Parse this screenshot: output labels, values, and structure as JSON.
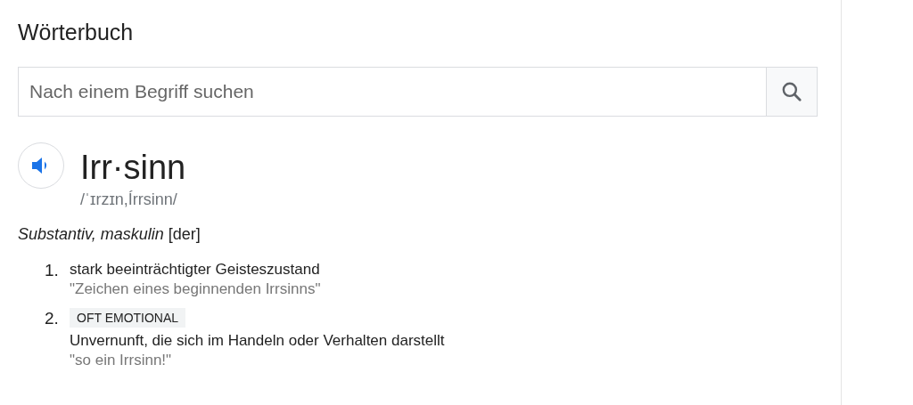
{
  "title": "Wörterbuch",
  "search": {
    "placeholder": "Nach einem Begriff suchen"
  },
  "entry": {
    "word": "Irr·sinn",
    "phonetic": "/ˈɪrzɪn,Írrsinn/",
    "part_of_speech": "*Substantiv, maskulin* [der]",
    "definitions": [
      {
        "number": "1.",
        "definition": "stark beeinträchtigter Geisteszustand",
        "example": "\"Zeichen eines beginnenden Irrsinns\""
      },
      {
        "number": "2.",
        "label": "OFT EMOTIONAL",
        "definition": "Unvernunft, die sich im Handeln oder Verhalten darstellt",
        "example": "\"so ein Irrsinn!\""
      }
    ]
  }
}
